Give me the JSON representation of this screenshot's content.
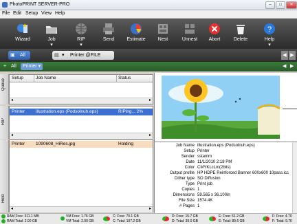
{
  "window": {
    "title": "PhotoPRINT SERVER-PRO"
  },
  "menu": [
    "File",
    "Edit",
    "Setup",
    "View",
    "Help"
  ],
  "toolbar": {
    "buttons": [
      {
        "label": "Wizard",
        "icon": "wand-icon"
      },
      {
        "label": "Job",
        "icon": "folder-icon"
      },
      {
        "label": "RIP",
        "icon": "globe-icon"
      },
      {
        "label": "Send",
        "icon": "printer-icon"
      },
      {
        "label": "Estimate",
        "icon": "estimate-icon"
      },
      {
        "label": "Nest",
        "icon": "nest-icon"
      },
      {
        "label": "Unnest",
        "icon": "unnest-icon"
      },
      {
        "label": "Abort",
        "icon": "abort-icon"
      },
      {
        "label": "Delete",
        "icon": "trash-icon"
      },
      {
        "label": "Help",
        "icon": "help-icon"
      }
    ]
  },
  "tabs": {
    "all": "All",
    "printer_tab": "Printer @FILE"
  },
  "subtabs": {
    "all": "All",
    "printer": "Printer"
  },
  "queue": {
    "columns": [
      "Setup",
      "Job Name",
      "Status"
    ],
    "side_label": "Queue"
  },
  "rip": {
    "side_label": "RIP",
    "row": {
      "setup": "Printer",
      "job": "illustration.eps (Podsolnuh.eps)",
      "status": "RIPing... 2%"
    }
  },
  "hold": {
    "side_label": "Hold",
    "row": {
      "setup": "Printer",
      "job": "1090608_HiRes.jpg",
      "status": "Holding"
    }
  },
  "details": [
    {
      "key": "Job Name",
      "value": "illustration.eps (Podsolnuh.eps)"
    },
    {
      "key": "Setup",
      "value": "Printer"
    },
    {
      "key": "Sender",
      "value": "sstamm"
    },
    {
      "key": "Date",
      "value": "11/1/2010 2:18 PM"
    },
    {
      "key": "Color",
      "value": "CMYKLcLm(2bits)"
    },
    {
      "key": "Output profile",
      "value": "HP HDPE Reinforced Banner 600x600 10pass.icc"
    },
    {
      "key": "Dither type",
      "value": "SO Diffusion"
    },
    {
      "key": "Type",
      "value": "Print job"
    },
    {
      "key": "Copies",
      "value": "1"
    },
    {
      "key": "Dimensions",
      "value": "59.565 x 36.100in"
    },
    {
      "key": "File Size",
      "value": "1574.4K"
    },
    {
      "key": "# Pages",
      "value": "1"
    }
  ],
  "status": [
    {
      "line1": "RAM Free: 311.1 MB",
      "line2": "RAM Total: 2.00 GB",
      "color": "#20b020"
    },
    {
      "line1": "VM Free: 1.76 GB",
      "line2": "VM Total: 2.00 GB",
      "color": "#20b020"
    },
    {
      "line1": "C: Free: 70.1 GB",
      "line2": "C: Total: 107.2 GB",
      "color": "#20b020"
    },
    {
      "line1": "D: Free: 15.7 GB",
      "line2": "D: Total: 39.0 GB",
      "color": "#20b020"
    },
    {
      "line1": "E: Free: 51.2 GB",
      "line2": "E: Total: 89.6 GB",
      "color": "#20b020"
    },
    {
      "line1": "F: Free: 4.70",
      "line2": "F: Total: 9.70",
      "color": "#20b020"
    }
  ],
  "colors": {
    "toolbar": "#3a3a3a",
    "selection": "#3c6fd0",
    "hold_row": "#f7dcc0",
    "accent_green": "#2e7d32"
  }
}
